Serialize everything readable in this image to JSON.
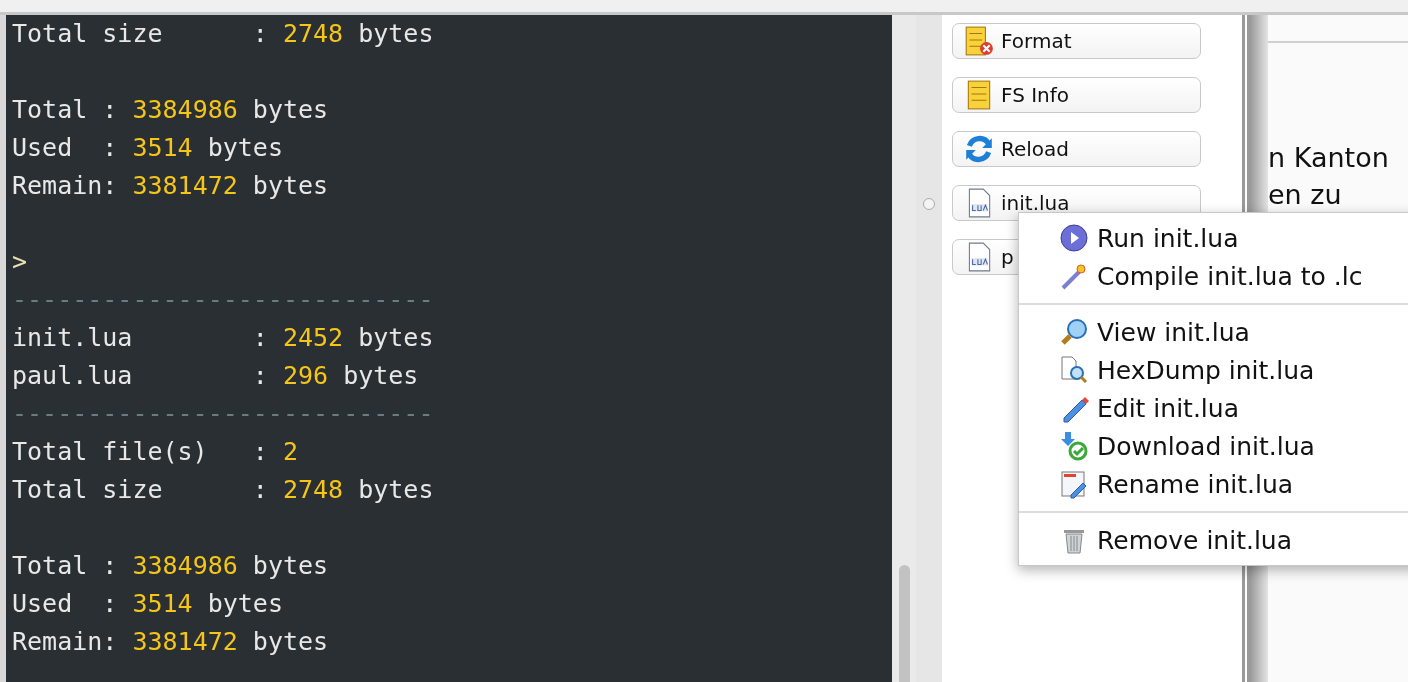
{
  "terminal": {
    "lines": [
      {
        "kind": "text",
        "parts": [
          {
            "kind": "plain",
            "text": "Total size      : "
          },
          {
            "kind": "number",
            "text": "2748"
          },
          {
            "kind": "plain",
            "text": " bytes"
          }
        ]
      },
      {
        "kind": "blank"
      },
      {
        "kind": "text",
        "parts": [
          {
            "kind": "plain",
            "text": "Total : "
          },
          {
            "kind": "number",
            "text": "3384986"
          },
          {
            "kind": "plain",
            "text": " bytes"
          }
        ]
      },
      {
        "kind": "text",
        "parts": [
          {
            "kind": "plain",
            "text": "Used  : "
          },
          {
            "kind": "number",
            "text": "3514"
          },
          {
            "kind": "plain",
            "text": " bytes"
          }
        ]
      },
      {
        "kind": "text",
        "parts": [
          {
            "kind": "plain",
            "text": "Remain: "
          },
          {
            "kind": "number",
            "text": "3381472"
          },
          {
            "kind": "plain",
            "text": " bytes"
          }
        ]
      },
      {
        "kind": "blank"
      },
      {
        "kind": "prompt",
        "text": ">"
      },
      {
        "kind": "rule",
        "text": "----------------------------"
      },
      {
        "kind": "text",
        "parts": [
          {
            "kind": "plain",
            "text": "init.lua        : "
          },
          {
            "kind": "number",
            "text": "2452"
          },
          {
            "kind": "plain",
            "text": " bytes"
          }
        ]
      },
      {
        "kind": "text",
        "parts": [
          {
            "kind": "plain",
            "text": "paul.lua        : "
          },
          {
            "kind": "number",
            "text": "296"
          },
          {
            "kind": "plain",
            "text": " bytes"
          }
        ]
      },
      {
        "kind": "rule",
        "text": "----------------------------"
      },
      {
        "kind": "text",
        "parts": [
          {
            "kind": "plain",
            "text": "Total file(s)   : "
          },
          {
            "kind": "number",
            "text": "2"
          }
        ]
      },
      {
        "kind": "text",
        "parts": [
          {
            "kind": "plain",
            "text": "Total size      : "
          },
          {
            "kind": "number",
            "text": "2748"
          },
          {
            "kind": "plain",
            "text": " bytes"
          }
        ]
      },
      {
        "kind": "blank"
      },
      {
        "kind": "text",
        "parts": [
          {
            "kind": "plain",
            "text": "Total : "
          },
          {
            "kind": "number",
            "text": "3384986"
          },
          {
            "kind": "plain",
            "text": " bytes"
          }
        ]
      },
      {
        "kind": "text",
        "parts": [
          {
            "kind": "plain",
            "text": "Used  : "
          },
          {
            "kind": "number",
            "text": "3514"
          },
          {
            "kind": "plain",
            "text": " bytes"
          }
        ]
      },
      {
        "kind": "text",
        "parts": [
          {
            "kind": "plain",
            "text": "Remain: "
          },
          {
            "kind": "number",
            "text": "3381472"
          },
          {
            "kind": "plain",
            "text": " bytes"
          }
        ]
      }
    ]
  },
  "file_buttons": [
    {
      "kind": "format",
      "label": "Format"
    },
    {
      "kind": "info",
      "label": "FS Info"
    },
    {
      "kind": "reload",
      "label": "Reload"
    },
    {
      "kind": "lua",
      "label": "init.lua"
    },
    {
      "kind": "lua",
      "label": "p"
    }
  ],
  "background_text": [
    "n Kanton",
    "en zu"
  ],
  "context_menu": {
    "groups": [
      [
        {
          "kind": "run",
          "label": "Run init.lua"
        },
        {
          "kind": "compile",
          "label": "Compile init.lua to .lc"
        }
      ],
      [
        {
          "kind": "view",
          "label": "View init.lua"
        },
        {
          "kind": "hexdump",
          "label": "HexDump init.lua"
        },
        {
          "kind": "edit",
          "label": "Edit init.lua"
        },
        {
          "kind": "download",
          "label": "Download init.lua"
        },
        {
          "kind": "rename",
          "label": "Rename init.lua"
        }
      ],
      [
        {
          "kind": "remove",
          "label": "Remove init.lua"
        }
      ]
    ]
  }
}
